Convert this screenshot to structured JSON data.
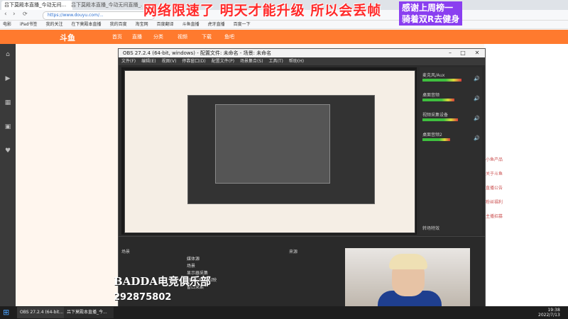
{
  "browser": {
    "tab1": "吕下莫殿本直播_今动无间...",
    "tab2": "吕下莫殿本直播_今动无间直播_...",
    "url": "https://www.douyu.com/...",
    "bookmarks": [
      "电影",
      "iPad书签",
      "我的关注",
      "在下莫殿本直播",
      "我的百度",
      "淘宝网",
      "百度翻译",
      "斗鱼直播",
      "虎牙直播",
      "百度一下"
    ]
  },
  "site": {
    "logo": "斗鱼",
    "nav": [
      "首页",
      "直播",
      "分类",
      "视频",
      "下载",
      "鱼吧"
    ],
    "right_links": [
      "小鱼产品",
      "关于斗鱼",
      "直播公告",
      "粉丝福利",
      "主播招募"
    ]
  },
  "overlay": {
    "banner": "网络限速了 明天才能升级 所以会丢帧",
    "thanks_line1": "感谢上周榜一",
    "thanks_line2": "骑着双R去健身"
  },
  "obs": {
    "title": "OBS 27.2.4 (64-bit, windows) - 配置文件: 未命名 - 场景: 未命名",
    "menu": [
      "文件(F)",
      "编辑(E)",
      "视图(V)",
      "停靠窗口(D)",
      "配置文件(P)",
      "场景集合(S)",
      "工具(T)",
      "帮助(H)"
    ],
    "mixer": [
      {
        "label": "麦克风/Aux",
        "level": 0.78
      },
      {
        "label": "桌面音频",
        "level": 0.64
      },
      {
        "label": "视频采集设备",
        "level": 0.71
      },
      {
        "label": "桌面音频2",
        "level": 0.55
      }
    ],
    "scenes_header": "来源",
    "scenes_label": "场景",
    "sources": [
      "媒体源",
      "场景",
      "显示器采集",
      "图像幻灯片放映",
      "窗口采集"
    ],
    "transitions_tab": "转场特效"
  },
  "watermark": {
    "brand": "BADDA电竞俱乐部",
    "room": "292875802"
  },
  "taskbar": {
    "app1": "OBS 27.2.4 (64-bit...",
    "app2": "吕下莫殿本直播_今...",
    "time": "19:38",
    "date": "2022/7/13"
  }
}
